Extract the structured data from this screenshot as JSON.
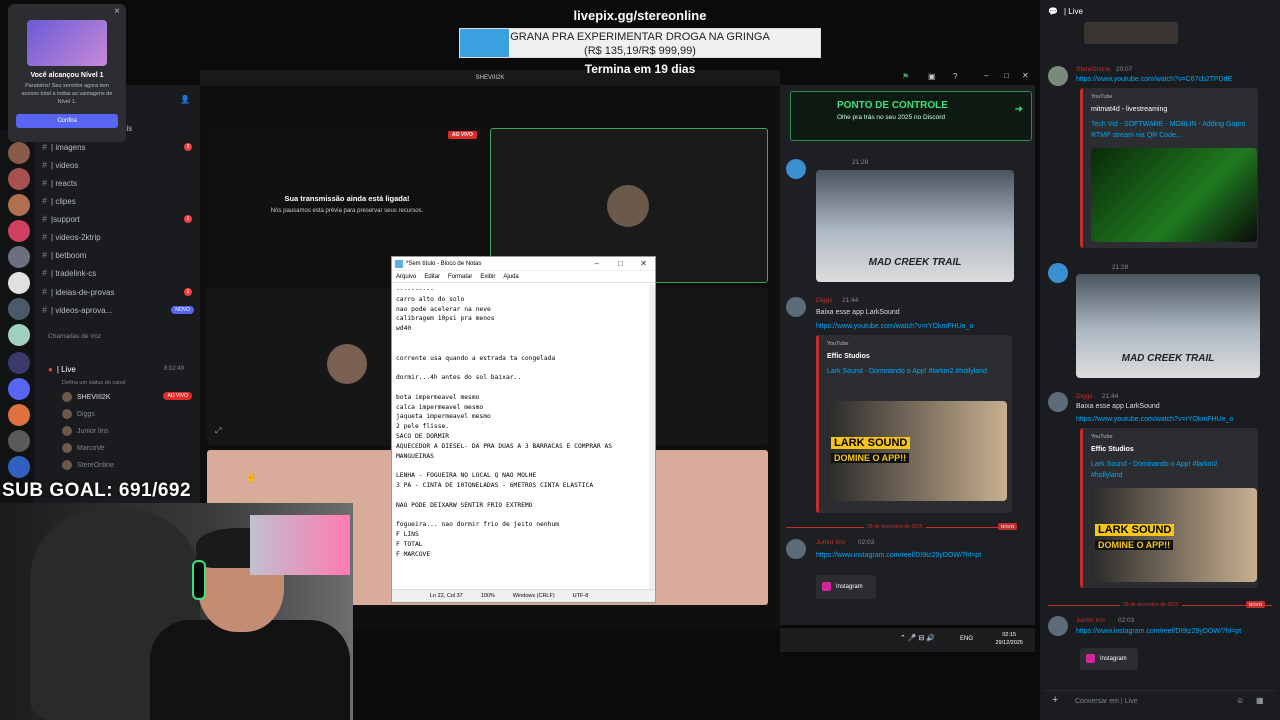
{
  "overlay": {
    "livepix": "livepix.gg/stereonline",
    "goal_line1": "GRANA PRA EXPERIMENTAR DROGA NA GRINGA",
    "goal_line2": "(R$ 135,19/R$ 999,99)",
    "goal_progress": 0.135,
    "termina": "Termina em 19 dias",
    "subgoal": "SUB GOAL: 691/692"
  },
  "level_popup": {
    "title": "Você alcançou Nível 1",
    "description": "Parabéns! Seu servidor agora tem acesso total a todas as vantagens de Nível 1.",
    "button": "Confira",
    "close": "×"
  },
  "channels": {
    "partial_label": "ais",
    "items": [
      {
        "label": "| imagens",
        "badge": "3"
      },
      {
        "label": "| videos",
        "badge": ""
      },
      {
        "label": "| reacts",
        "badge": ""
      },
      {
        "label": "| clipes",
        "badge": ""
      },
      {
        "label": "|support",
        "badge": "1"
      },
      {
        "label": "| videos-2ktrip",
        "badge": ""
      },
      {
        "label": "| betboom",
        "badge": ""
      },
      {
        "label": "| tradelink-cs",
        "badge": ""
      },
      {
        "label": "| ideias-de-provas",
        "badge": "1"
      },
      {
        "label": "| videos-aprova...",
        "badge": "NOVO"
      }
    ],
    "voice_header": "Chamadas de Voz",
    "live_channel": "| Live",
    "live_time": "8:02:49",
    "status_hint": "Defina um status do canal",
    "voice_users": [
      "SHEVIII2K",
      "Diggs",
      "Junior lins",
      "MarcoVe",
      "StereOnline"
    ],
    "ao_vivo": "AO VIVO"
  },
  "stream": {
    "user": "SHEVIII2K",
    "ao_vivo": "AO VIVO",
    "paused_title": "Sua transmissão ainda está ligada!",
    "paused_desc": "Nós pausamos esta prévia para preservar seus recursos."
  },
  "notepad": {
    "title": "*Sem título - Bloco de Notas",
    "menu": [
      "Arquivo",
      "Editar",
      "Formatar",
      "Exibir",
      "Ajuda"
    ],
    "content": "----------\ncarro alto do solo\nnao pode acelerar na neve\ncalibragem 10psi pra menos\nwd40\n\n\ncorrente usa quando a estrada ta congelada\n\ndormir...4h antes do sol baixar..\n\nbota impermeavel mesmo\ncalca impermeavel mesmo\njaqueta impermeavel mesmo\n2 pele flisse.\nSACO DE DORMIR\nAQUECEDOR A DIESEL- DA PRA DUAS A 3 BARRACAS E COMPRAR AS\nMANGUEIRAS\n\nLENHA - FOGUEIRA NO LOCAL Q NAO MOLHE\n3 PA - CINTA DE 10TONELADAS - 6METROS CINTA ELASTICA\n\nNAO PODE DEIXARW SENTIR FRIO EXTREMO\n\nfogueira... nao dormir frio de jeito nenhum\nF LINS\nF TOTAL\nF MARCOVE",
    "status": [
      "Ln 22, Col 37",
      "100%",
      "Windows (CRLF)",
      "UTF-8"
    ]
  },
  "midchat": {
    "banner_title": "PONTO DE CONTROLE",
    "banner_sub": "Olhe pra trás no seu 2025 no Discord",
    "msg1_time": "21:28",
    "mad_creek": "MAD CREEK TRAIL",
    "msg2_user": "Diggs",
    "msg2_time": "21:44",
    "msg2_text": "Baixa esse app LarkSound",
    "msg2_link": "https://www.youtube.com/watch?v=rYOkmFHUe_o",
    "embed_provider": "YouTube",
    "embed_title": "Effic Studios",
    "embed_link": "Lark Sound - Dominando o App! #larkm2 #hollyland",
    "lark1": "LARK SOUND",
    "lark2": "DOMINE O APP!!",
    "divider": "29 de dezembro de 2025",
    "novo": "NOVO",
    "msg3_user": "Junior lins",
    "msg3_time": "02:03",
    "msg3_link": "https://www.instagram.com/reel/DI9tz29yDOW/?hl=pt",
    "instagram": "Instagram"
  },
  "rightpanel": {
    "header": "| Live",
    "msg0_user": "StereOnline",
    "msg0_time": "20:07",
    "msg0_link": "https://www.youtube.com/watch?v=C67cb2TPDdE",
    "emb0_provider": "YouTube",
    "emb0_title": "mitmat4d - livestreaming",
    "emb0_link": "Tech Vid - SOFTWARE - MOBLIN - Adding Gopro RTMP stream via QR Code...",
    "msg1_time": "21:28",
    "mad_creek": "MAD CREEK TRAIL",
    "msg2_user": "Diggs",
    "msg2_time": "21:44",
    "msg2_text": "Baixa esse app LarkSound",
    "msg2_link": "https://www.youtube.com/watch?v=rYOkmFHUe_o",
    "emb2_provider": "YouTube",
    "emb2_title": "Effic Studios",
    "emb2_link": "Lark Sound - Dominando o App! #larkm2 #hollyland",
    "lark1": "LARK SOUND",
    "lark2": "DOMINE O APP!!",
    "divider": "29 de dezembro de 2025",
    "novo": "NOVO",
    "msg3_user": "Junior lins",
    "msg3_time": "02:03",
    "msg3_link": "https://www.instagram.com/reel/DI9tz29yDOW/?hl=pt",
    "instagram": "Instagram",
    "input_placeholder": "Conversar em  | Live"
  },
  "taskbar": {
    "lang": "ENG",
    "time": "02:15",
    "date": "29/12/2025"
  },
  "colors": {
    "discord_blurple": "#5865f2",
    "live_red": "#c32e2e",
    "link_blue": "#00a8fc",
    "goal_fill": "#3aa0e0"
  }
}
